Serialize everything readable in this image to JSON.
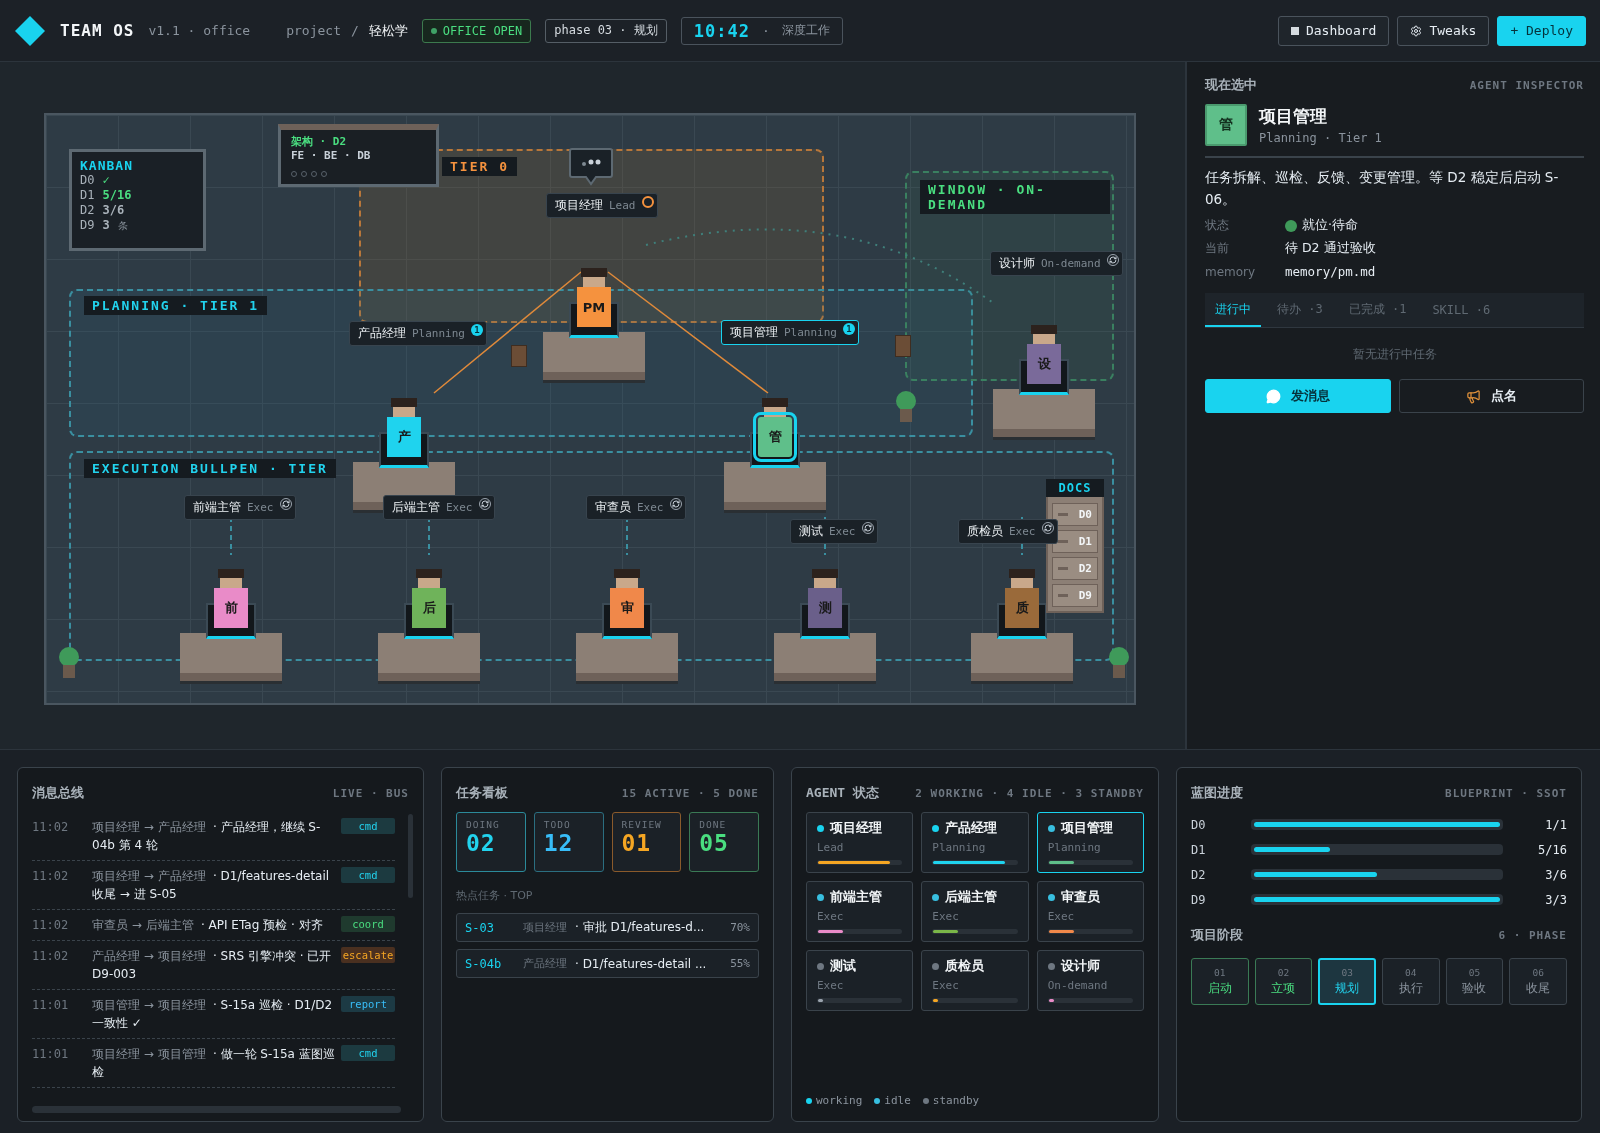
{
  "header": {
    "logo": "TEAM OS",
    "version": "v1.1 · office",
    "breadcrumb": [
      "project",
      "轻松学"
    ],
    "breadcrumb_separator": "/",
    "status_badge": {
      "label": "OFFICE OPEN",
      "on": true
    },
    "phase": "phase 03 · 规划",
    "clock": {
      "time": "10:42",
      "separator": "·",
      "mode": "深度工作"
    },
    "actions": [
      {
        "label": "Dashboard",
        "kind": "dashboard",
        "primary": false
      },
      {
        "label": "Tweaks",
        "kind": "tweaks",
        "primary": false
      },
      {
        "label": "+ Deploy",
        "kind": "deploy",
        "primary": true
      }
    ]
  },
  "office": {
    "kanban": {
      "title": "KANBAN",
      "rows": [
        {
          "key": "D0",
          "value": "✓",
          "highlight": true
        },
        {
          "key": "D1",
          "value": "5/16",
          "highlight": true
        },
        {
          "key": "D2",
          "value": "3/6",
          "highlight": false
        },
        {
          "key": "D9",
          "value": "3",
          "unit": "条",
          "highlight": false
        }
      ]
    },
    "whiteboard": {
      "lines": [
        "架构 · D2",
        "FE · BE · DB"
      ]
    },
    "zones": [
      {
        "kind": "tier0",
        "label": "TIER 0"
      },
      {
        "kind": "planning",
        "label": "PLANNING · TIER 1"
      },
      {
        "kind": "window",
        "label": "WINDOW · ON-DEMAND"
      },
      {
        "kind": "execution",
        "label": "EXECUTION BULLPEN · TIER"
      }
    ],
    "agents": [
      {
        "name": "项目经理",
        "role": "Lead",
        "glyph": "PM",
        "color": "#f5923e",
        "selected": false,
        "badge": {
          "kind": "lead"
        }
      },
      {
        "name": "产品经理",
        "role": "Planning",
        "glyph": "产",
        "color": "#1fd3ee",
        "selected": false,
        "badge": {
          "kind": "count",
          "text": "1"
        }
      },
      {
        "name": "项目管理",
        "role": "Planning",
        "glyph": "管",
        "color": "#5fbf8a",
        "selected": true,
        "badge": {
          "kind": "count",
          "text": "1"
        }
      },
      {
        "name": "设计师",
        "role": "On-demand",
        "glyph": "设",
        "color": "#7a6a9a",
        "selected": false,
        "badge": {
          "kind": "sync"
        }
      },
      {
        "name": "前端主管",
        "role": "Exec",
        "glyph": "前",
        "color": "#e98bc8",
        "selected": false,
        "badge": {
          "kind": "sync"
        }
      },
      {
        "name": "后端主管",
        "role": "Exec",
        "glyph": "后",
        "color": "#6fb35a",
        "selected": false,
        "badge": {
          "kind": "sync"
        }
      },
      {
        "name": "审查员",
        "role": "Exec",
        "glyph": "审",
        "color": "#f0884a",
        "selected": false,
        "badge": {
          "kind": "sync"
        }
      },
      {
        "name": "测试",
        "role": "Exec",
        "glyph": "测",
        "color": "#6a5f8a",
        "selected": false,
        "badge": {
          "kind": "sync"
        }
      },
      {
        "name": "质检员",
        "role": "Exec",
        "glyph": "质",
        "color": "#9a6a3a",
        "selected": false,
        "badge": {
          "kind": "sync"
        }
      }
    ],
    "docs": {
      "title": "DOCS",
      "drawers": [
        "D0",
        "D1",
        "D2",
        "D9"
      ]
    }
  },
  "inspector": {
    "title": "现在选中",
    "subtitle": "AGENT INSPECTOR",
    "avatar": "管",
    "name": "项目管理",
    "meta": "Planning · Tier 1",
    "description": "任务拆解、巡检、反馈、变更管理。等 D2 稳定后启动 S-06。",
    "fields": [
      {
        "label": "状态",
        "value": "就位·待命",
        "kind": "status"
      },
      {
        "label": "当前",
        "value": "待 D2 通过验收",
        "kind": "text"
      },
      {
        "label": "memory",
        "value": "memory/pm.md",
        "kind": "mono"
      }
    ],
    "tabs": [
      {
        "label": "进行中",
        "selected": true
      },
      {
        "label": "待办 ·3",
        "selected": false
      },
      {
        "label": "已完成 ·1",
        "selected": false
      },
      {
        "label": "SKILL ·6",
        "selected": false
      }
    ],
    "empty": "暂无进行中任务",
    "buttons": [
      {
        "label": "发消息",
        "kind": "message",
        "primary": true
      },
      {
        "label": "点名",
        "kind": "callout",
        "primary": false
      }
    ]
  },
  "message_bus": {
    "title": "消息总线",
    "meta": "LIVE · BUS",
    "messages": [
      {
        "time": "11:02",
        "route": "项目经理 → 产品经理",
        "text": "· 产品经理，继续 S-04b 第 4 轮",
        "tag": {
          "label": "cmd",
          "kind": "cmd"
        }
      },
      {
        "time": "11:02",
        "route": "项目经理 → 产品经理",
        "text": "· D1/features-detail 收尾 → 进 S-05",
        "tag": {
          "label": "cmd",
          "kind": "cmd"
        }
      },
      {
        "time": "11:02",
        "route": "审查员 → 后端主管",
        "text": "· API ETag 预检 · 对齐",
        "tag": {
          "label": "coord",
          "kind": "coord"
        }
      },
      {
        "time": "11:02",
        "route": "产品经理 → 项目经理",
        "text": "· SRS 引擎冲突 · 已开 D9-003",
        "tag": {
          "label": "escalate",
          "kind": "escalate"
        }
      },
      {
        "time": "11:01",
        "route": "项目管理 → 项目经理",
        "text": "· S-15a 巡检 · D1/D2 一致性 ✓",
        "tag": {
          "label": "report",
          "kind": "report"
        }
      },
      {
        "time": "11:01",
        "route": "项目经理 → 项目管理",
        "text": "· 做一轮 S-15a 蓝图巡检",
        "tag": {
          "label": "cmd",
          "kind": "cmd"
        }
      }
    ]
  },
  "task_board": {
    "title": "任务看板",
    "meta": "15 ACTIVE · 5 DONE",
    "stats": [
      {
        "label": "DOING",
        "value": "02",
        "kind": "doing"
      },
      {
        "label": "TODO",
        "value": "12",
        "kind": "todo"
      },
      {
        "label": "REVIEW",
        "value": "01",
        "kind": "review"
      },
      {
        "label": "DONE",
        "value": "05",
        "kind": "done"
      }
    ],
    "hot_title": "热点任务 · TOP",
    "tasks": [
      {
        "id": "S-03",
        "owner": "项目经理",
        "title": "· 审批 D1/features-d...",
        "percent": "70%"
      },
      {
        "id": "S-04b",
        "owner": "产品经理",
        "title": "· D1/features-detail ...",
        "percent": "55%"
      }
    ]
  },
  "agent_status": {
    "title": "AGENT 状态",
    "meta": "2 WORKING · 4 IDLE · 3 STANDBY",
    "cards": [
      {
        "name": "项目经理",
        "role": "Lead",
        "kind": "working",
        "level": 0.86,
        "color": "#f5a623",
        "selected": false
      },
      {
        "name": "产品经理",
        "role": "Planning",
        "kind": "working",
        "level": 0.86,
        "color": "#1fd3ee",
        "selected": false
      },
      {
        "name": "项目管理",
        "role": "Planning",
        "kind": "idle",
        "level": 0.3,
        "color": "#5fbf8a",
        "selected": true
      },
      {
        "name": "前端主管",
        "role": "Exec",
        "kind": "idle",
        "level": 0.3,
        "color": "#e98bc8",
        "selected": false
      },
      {
        "name": "后端主管",
        "role": "Exec",
        "kind": "idle",
        "level": 0.3,
        "color": "#7ab648",
        "selected": false
      },
      {
        "name": "审查员",
        "role": "Exec",
        "kind": "idle",
        "level": 0.3,
        "color": "#f0884a",
        "selected": false
      },
      {
        "name": "测试",
        "role": "Exec",
        "kind": "standby",
        "level": 0.04,
        "color": "#9aa3ad",
        "selected": false
      },
      {
        "name": "质检员",
        "role": "Exec",
        "kind": "standby",
        "level": 0.05,
        "color": "#f5a623",
        "selected": false
      },
      {
        "name": "设计师",
        "role": "On-demand",
        "kind": "standby",
        "level": 0.05,
        "color": "#e98bc8",
        "selected": false
      }
    ],
    "legend": [
      {
        "label": "working",
        "kind": "working"
      },
      {
        "label": "idle",
        "kind": "idle"
      },
      {
        "label": "standby",
        "kind": "standby"
      }
    ]
  },
  "blueprint": {
    "title": "蓝图进度",
    "meta": "BLUEPRINT · SSOT",
    "rows": [
      {
        "label": "D0",
        "level": 1,
        "value": "1/1"
      },
      {
        "label": "D1",
        "level": 0.31,
        "value": "5/16"
      },
      {
        "label": "D2",
        "level": 0.5,
        "value": "3/6"
      },
      {
        "label": "D9",
        "level": 1,
        "value": "3/3"
      }
    ],
    "phase_title": "项目阶段",
    "phase_meta": "6 · PHASE",
    "phases": [
      {
        "num": "01",
        "label": "启动",
        "kind": "done"
      },
      {
        "num": "02",
        "label": "立项",
        "kind": "done"
      },
      {
        "num": "03",
        "label": "规划",
        "kind": "current"
      },
      {
        "num": "04",
        "label": "执行",
        "kind": "pending"
      },
      {
        "num": "05",
        "label": "验收",
        "kind": "pending"
      },
      {
        "num": "06",
        "label": "收尾",
        "kind": "pending"
      }
    ]
  }
}
